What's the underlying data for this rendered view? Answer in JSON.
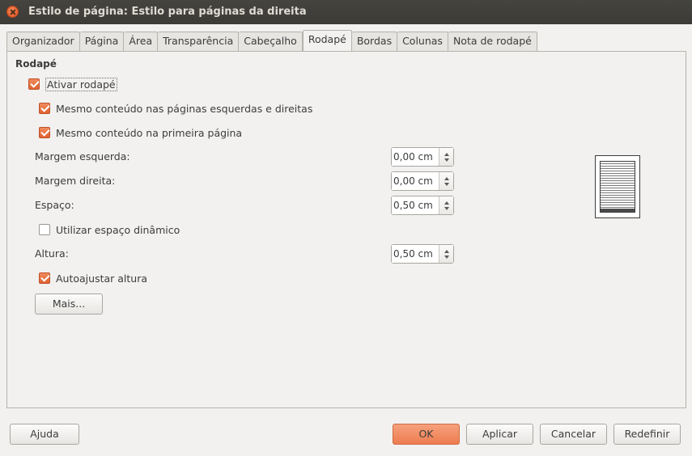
{
  "window": {
    "title": "Estilo de página: Estilo para páginas da direita"
  },
  "tabs": [
    {
      "label": "Organizador"
    },
    {
      "label": "Página"
    },
    {
      "label": "Área"
    },
    {
      "label": "Transparência"
    },
    {
      "label": "Cabeçalho"
    },
    {
      "label": "Rodapé"
    },
    {
      "label": "Bordas"
    },
    {
      "label": "Colunas"
    },
    {
      "label": "Nota de rodapé"
    }
  ],
  "active_tab": "Rodapé",
  "footer": {
    "section_title": "Rodapé",
    "enable": {
      "label": "Ativar rodapé",
      "checked": true
    },
    "same_left_right": {
      "label": "Mesmo conteúdo nas páginas esquerdas e direitas",
      "checked": true
    },
    "same_first_page": {
      "label": "Mesmo conteúdo na primeira página",
      "checked": true
    },
    "left_margin": {
      "label": "Margem esquerda:",
      "value": "0,00 cm"
    },
    "right_margin": {
      "label": "Margem direita:",
      "value": "0,00 cm"
    },
    "spacing": {
      "label": "Espaço:",
      "value": "0,50 cm"
    },
    "dynamic_spacing": {
      "label": "Utilizar espaço dinâmico",
      "checked": false
    },
    "height": {
      "label": "Altura:",
      "value": "0,50 cm"
    },
    "autofit_height": {
      "label": "Autoajustar altura",
      "checked": true
    },
    "more_button": "Mais..."
  },
  "buttons": {
    "help": "Ajuda",
    "ok": "OK",
    "apply": "Aplicar",
    "cancel": "Cancelar",
    "reset": "Redefinir"
  },
  "colors": {
    "accent": "#ee7c4f",
    "titlebar": "#3c3b37"
  }
}
